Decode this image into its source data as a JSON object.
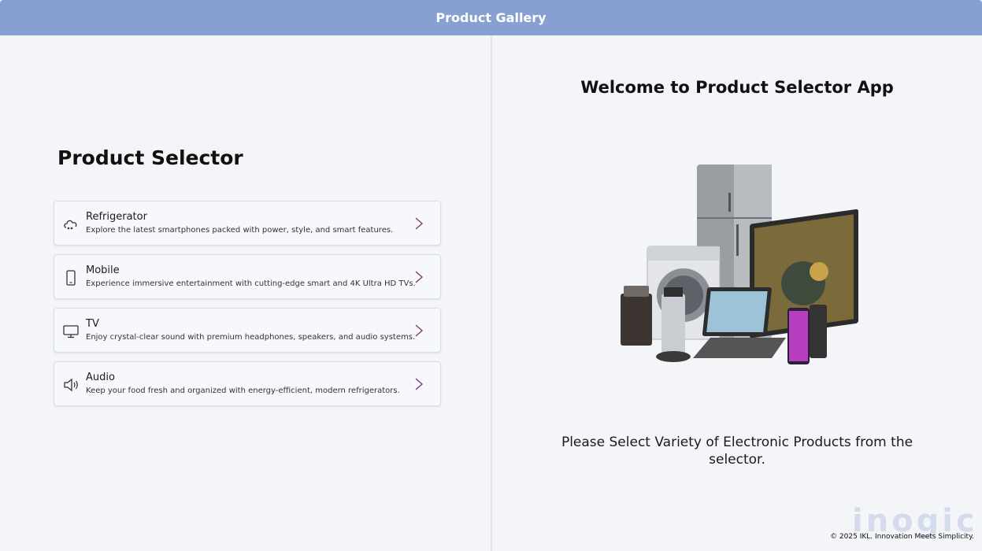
{
  "header": {
    "title": "Product Gallery"
  },
  "selector": {
    "title": "Product Selector",
    "items": [
      {
        "label": "Refrigerator",
        "description": "Explore the latest smartphones packed with power, style, and smart features.",
        "icon": "cloud-device-icon"
      },
      {
        "label": "Mobile",
        "description": "Experience immersive entertainment with cutting-edge smart and 4K Ultra HD TVs.",
        "icon": "phone-icon"
      },
      {
        "label": "TV",
        "description": "Enjoy crystal-clear sound with premium headphones, speakers, and audio systems.",
        "icon": "monitor-icon"
      },
      {
        "label": "Audio",
        "description": "Keep your food fresh and organized with energy-efficient, modern refrigerators.",
        "icon": "speaker-icon"
      }
    ]
  },
  "welcome": {
    "title": "Welcome to Product Selector App",
    "instructions": "Please Select Variety of Electronic Products from the selector."
  },
  "footer": {
    "brand": "inogic",
    "copyright": "© 2025 IKL. Innovation Meets Simplicity."
  },
  "colors": {
    "header": "#879fd1",
    "background": "#f3f5f9",
    "chevron": "#7a3e7a"
  }
}
